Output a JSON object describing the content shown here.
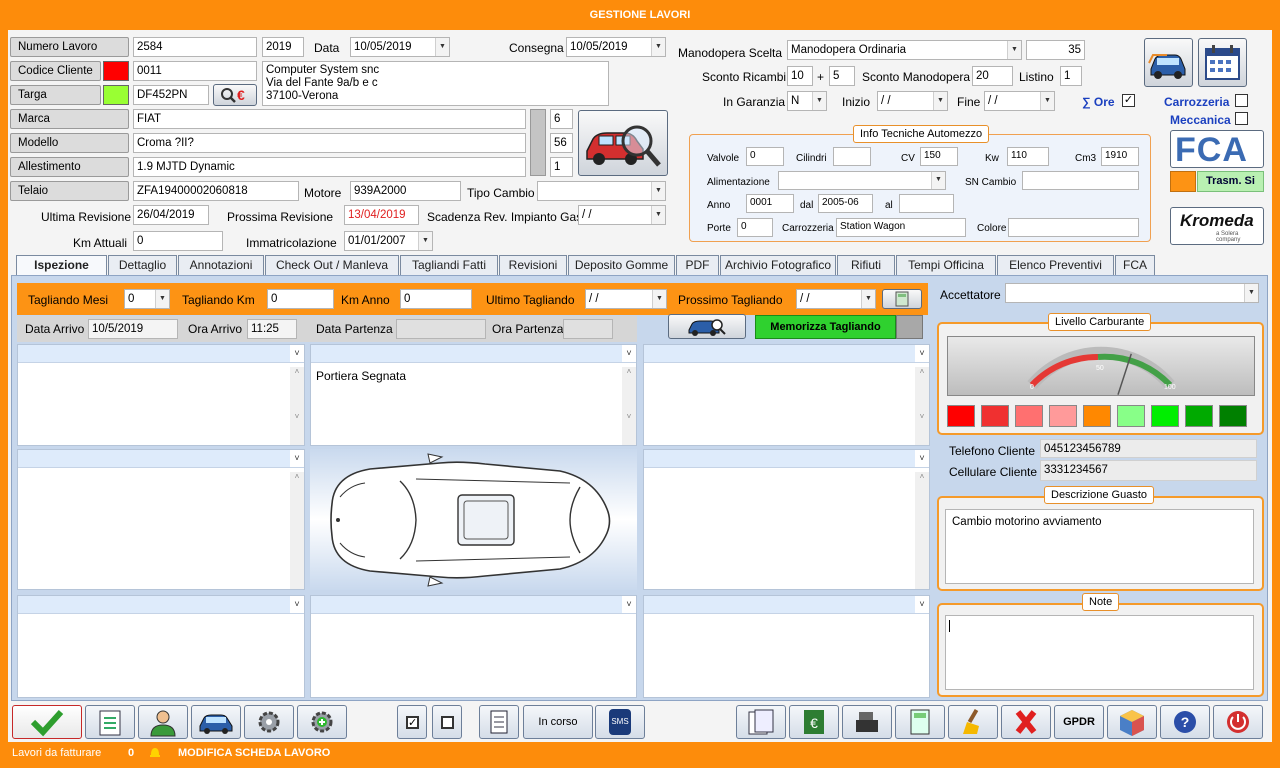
{
  "window": {
    "title": "GESTIONE LAVORI"
  },
  "header": {
    "numero_lavoro": {
      "label": "Numero Lavoro",
      "value": "2584",
      "year": "2019"
    },
    "data": {
      "label": "Data",
      "value": "10/05/2019"
    },
    "consegna": {
      "label": "Consegna",
      "value": "10/05/2019"
    },
    "codice_cliente": {
      "label": "Codice Cliente",
      "value": "0011"
    },
    "cliente_address": [
      "Computer System snc",
      "Via del Fante 9a/b e c",
      "37100-Verona"
    ],
    "targa": {
      "label": "Targa",
      "value": "DF452PN"
    },
    "marca": {
      "label": "Marca",
      "value": "FIAT",
      "side": "6"
    },
    "modello": {
      "label": "Modello",
      "value": "Croma ?II?",
      "side": "56"
    },
    "allestimento": {
      "label": "Allestimento",
      "value": "1.9 MJTD Dynamic",
      "side": "1"
    },
    "telaio": {
      "label": "Telaio",
      "value": "ZFA19400002060818"
    },
    "motore": {
      "label": "Motore",
      "value": "939A2000"
    },
    "tipo_cambio": {
      "label": "Tipo Cambio",
      "value": ""
    },
    "ultima_revisione": {
      "label": "Ultima Revisione",
      "value": "26/04/2019"
    },
    "prossima_revisione": {
      "label": "Prossima Revisione",
      "value": "13/04/2019"
    },
    "scadenza_gas": {
      "label": "Scadenza Rev. Impianto Gas",
      "value": "/ /"
    },
    "km_attuali": {
      "label": "Km Attuali",
      "value": "0"
    },
    "immatricolazione": {
      "label": "Immatricolazione",
      "value": "01/01/2007"
    }
  },
  "manodopera": {
    "scelta": {
      "label": "Manodopera Scelta",
      "value": "Manodopera Ordinaria",
      "rate": "35"
    },
    "sconto_ricambi": {
      "label": "Sconto Ricambi",
      "value1": "10",
      "plus": "+",
      "value2": "5"
    },
    "sconto_manodopera": {
      "label": "Sconto Manodopera",
      "value": "20"
    },
    "listino": {
      "label": "Listino",
      "value": "1"
    },
    "in_garanzia": {
      "label": "In Garanzia",
      "value": "N"
    },
    "inizio": {
      "label": "Inizio",
      "value": "/ /"
    },
    "fine": {
      "label": "Fine",
      "value": "/ /"
    },
    "ore": {
      "label": "∑ Ore",
      "check": "✓"
    },
    "carrozzeria": {
      "label": "Carrozzeria"
    },
    "meccanica": {
      "label": "Meccanica"
    }
  },
  "info_tecniche": {
    "title": "Info Tecniche Automezzo",
    "valvole": {
      "label": "Valvole",
      "value": "0"
    },
    "cilindri": {
      "label": "Cilindri",
      "value": ""
    },
    "cv": {
      "label": "CV",
      "value": "150"
    },
    "kw": {
      "label": "Kw",
      "value": "110"
    },
    "cm3": {
      "label": "Cm3",
      "value": "1910"
    },
    "alimentazione": {
      "label": "Alimentazione",
      "value": ""
    },
    "sn_cambio": {
      "label": "SN Cambio",
      "value": ""
    },
    "anno": {
      "label": "Anno",
      "value": "0001"
    },
    "dal": {
      "label": "dal",
      "value": "2005-06"
    },
    "al": {
      "label": "al",
      "value": ""
    },
    "porte": {
      "label": "Porte",
      "value": "0"
    },
    "carrozzeria": {
      "label": "Carrozzeria",
      "value": "Station Wagon"
    },
    "colore": {
      "label": "Colore",
      "value": ""
    }
  },
  "brand": {
    "fca_logo": "FCA",
    "trasm": "Trasm. Si",
    "kromeda": "Kromeda",
    "kromeda_sub": "a Solera company"
  },
  "tabs": [
    "Ispezione",
    "Dettaglio",
    "Annotazioni",
    "Check Out / Manleva",
    "Tagliandi Fatti",
    "Revisioni",
    "Deposito Gomme",
    "PDF",
    "Archivio Fotografico",
    "Rifiuti",
    "Tempi Officina",
    "Elenco Preventivi",
    "FCA"
  ],
  "ispezione": {
    "tagliando_mesi": {
      "label": "Tagliando Mesi",
      "value": "0"
    },
    "tagliando_km": {
      "label": "Tagliando Km",
      "value": "0"
    },
    "km_anno": {
      "label": "Km Anno",
      "value": "0"
    },
    "ultimo_tagliando": {
      "label": "Ultimo Tagliando",
      "value": "/ /"
    },
    "prossimo_tagliando": {
      "label": "Prossimo Tagliando",
      "value": "/ /"
    },
    "data_arrivo": {
      "label": "Data Arrivo",
      "value": "10/5/2019"
    },
    "ora_arrivo": {
      "label": "Ora Arrivo",
      "value": "11:25"
    },
    "data_partenza": {
      "label": "Data Partenza",
      "value": ""
    },
    "ora_partenza": {
      "label": "Ora Partenza",
      "value": ""
    },
    "memorizza": "Memorizza Tagliando",
    "zone_note": "Portiera Segnata"
  },
  "right": {
    "accettatore": {
      "label": "Accettatore",
      "value": ""
    },
    "carburante": {
      "title": "Livello Carburante",
      "min": "0",
      "mid": "50",
      "max": "100",
      "level": 0.6
    },
    "telefono": {
      "label": "Telefono Cliente",
      "value": "045123456789"
    },
    "cellulare": {
      "label": "Cellulare Cliente",
      "value": "3331234567"
    },
    "guasto": {
      "title": "Descrizione Guasto",
      "value": "Cambio motorino avviamento"
    },
    "note": {
      "title": "Note",
      "value": ""
    }
  },
  "colors": {
    "orange": "#fd8c0b",
    "codice_swatch": "#ff0000",
    "targa_swatch": "#99ff33",
    "fuel": [
      "#ff0000",
      "#f03030",
      "#ff7070",
      "#ff9a9a",
      "#ff8800",
      "#88ff88",
      "#00ee00",
      "#00aa00",
      "#008000"
    ]
  },
  "toolbar": {
    "in_corso": "In corso",
    "sms": "SMS",
    "gpdr": "GPDR"
  },
  "status": {
    "lavori": "Lavori da fatturare",
    "count": "0",
    "modifica": "MODIFICA SCHEDA LAVORO"
  }
}
